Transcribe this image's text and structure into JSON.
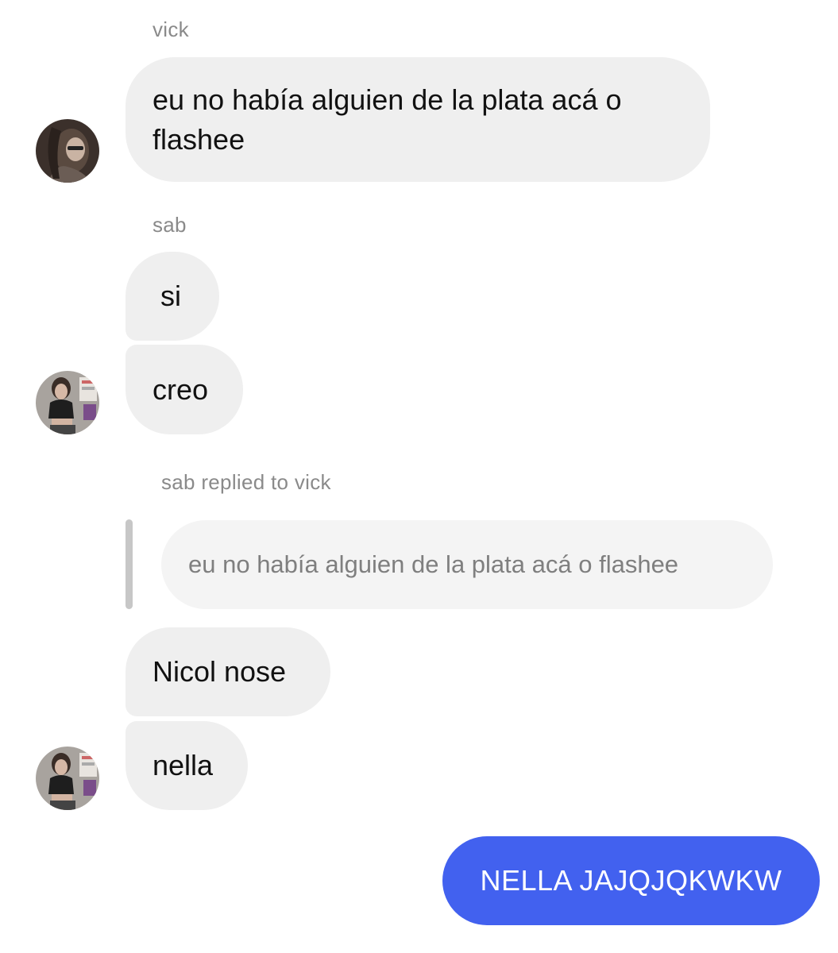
{
  "colors": {
    "received_bubble": "#efefef",
    "reply_bubble": "#f4f4f4",
    "sent_bubble": "#4261ef",
    "sender_name": "#8a8a8a"
  },
  "messages": {
    "group1": {
      "sender": "vick",
      "text_line1": "eu no había alguien de la plata acá o",
      "text_line2": "flashee",
      "avatar": "avatar-vick"
    },
    "group2": {
      "sender": "sab",
      "msg1": "si",
      "msg2": "creo",
      "avatar": "avatar-sab"
    },
    "reply": {
      "header": "sab replied to vick",
      "quoted": "eu no había alguien de la plata acá o flashee"
    },
    "group3": {
      "msg1": "Nicol nose",
      "msg2": "nella",
      "avatar": "avatar-sab"
    },
    "sent": {
      "text": "NELLA JAJQJQKWKW"
    }
  }
}
